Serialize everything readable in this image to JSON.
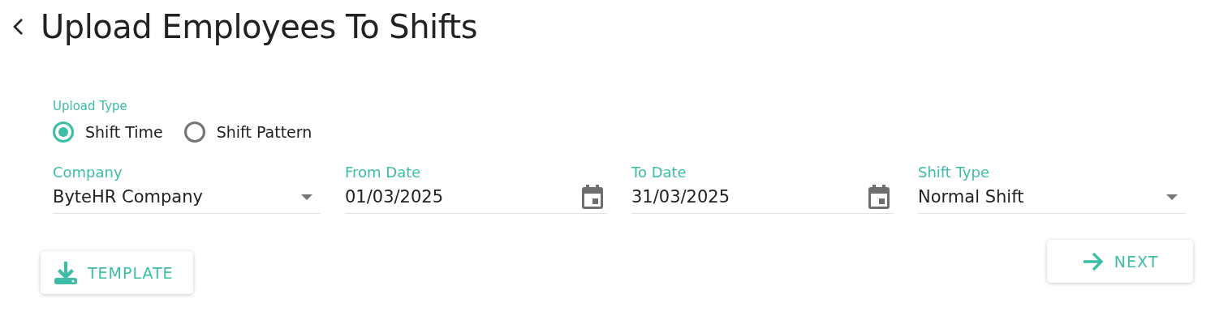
{
  "header": {
    "title": "Upload Employees To Shifts"
  },
  "upload_type": {
    "label": "Upload Type",
    "options": [
      {
        "label": "Shift Time",
        "selected": true
      },
      {
        "label": "Shift Pattern",
        "selected": false
      }
    ]
  },
  "fields": [
    {
      "kind": "select",
      "label": "Company",
      "value": "ByteHR Company"
    },
    {
      "kind": "date",
      "label": "From Date",
      "value": "01/03/2025"
    },
    {
      "kind": "date",
      "label": "To Date",
      "value": "31/03/2025"
    },
    {
      "kind": "select",
      "label": "Shift Type",
      "value": "Normal Shift"
    }
  ],
  "buttons": [
    {
      "kind": "download",
      "label": "TEMPLATE"
    },
    {
      "kind": "next",
      "label": "NEXT"
    }
  ]
}
